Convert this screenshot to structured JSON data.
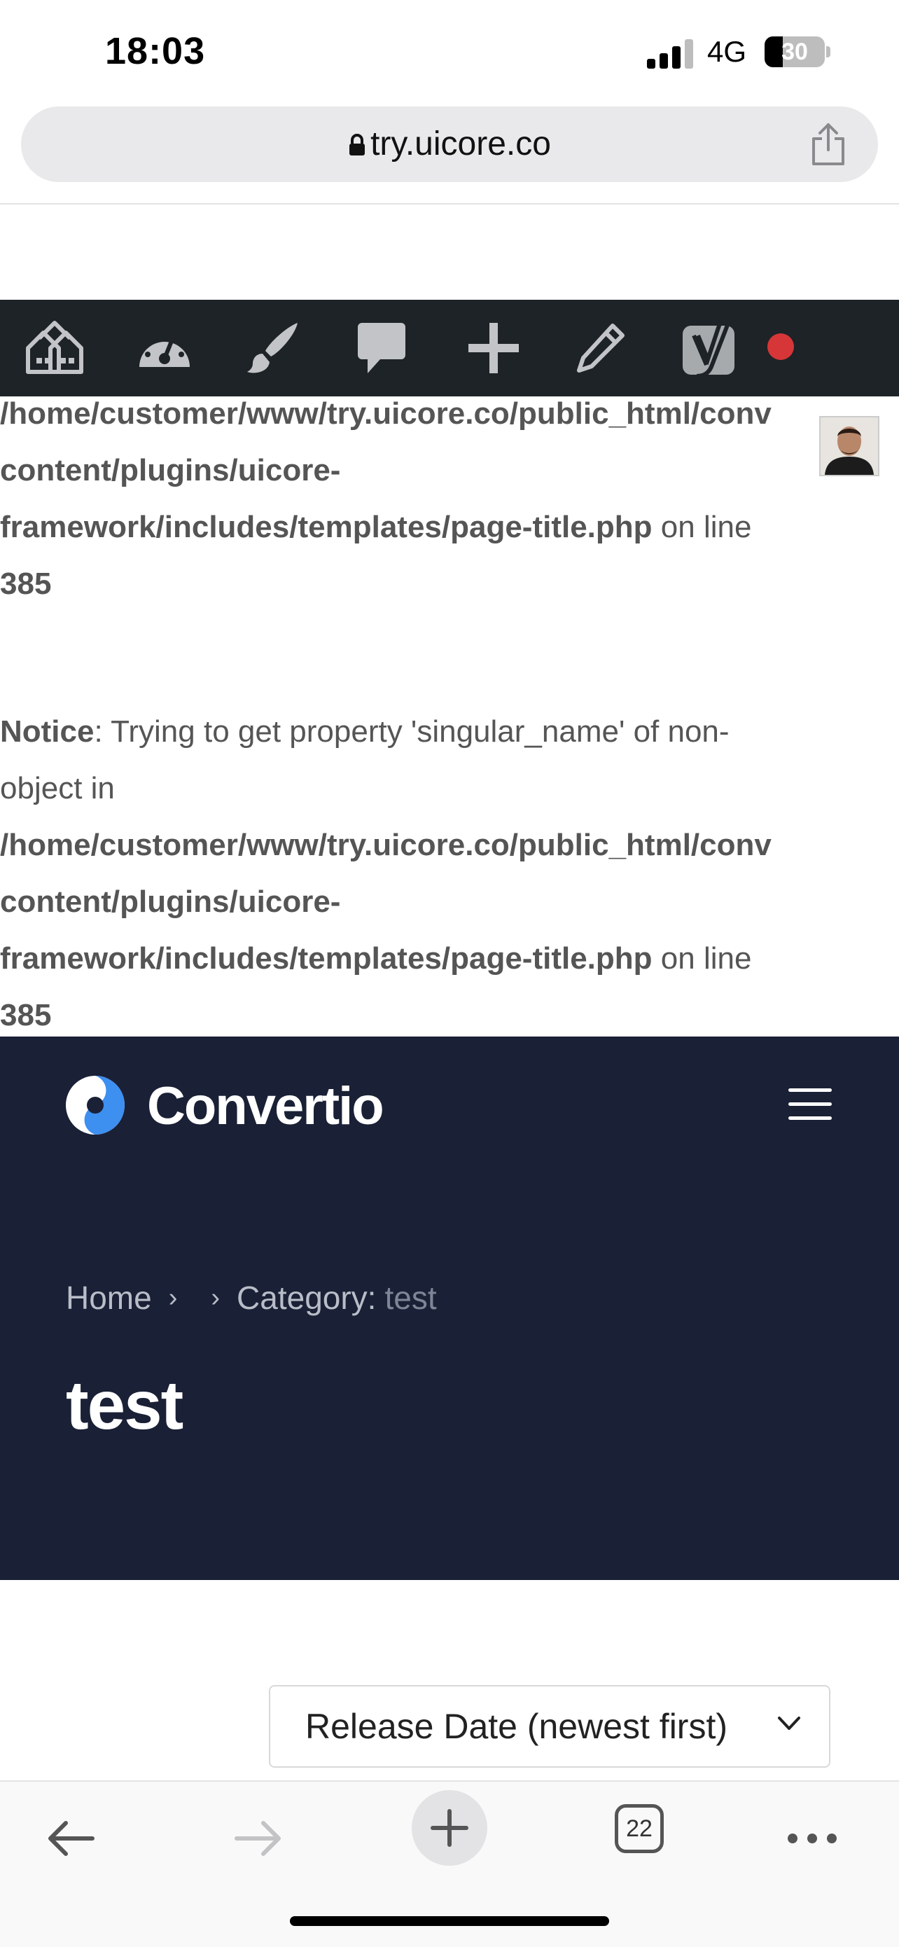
{
  "status_bar": {
    "time": "18:03",
    "network": "4G",
    "battery": "30"
  },
  "browser": {
    "url": "try.uicore.co"
  },
  "admin_bar": {
    "icons": [
      "multisite-icon",
      "dashboard-icon",
      "customize-icon",
      "comments-icon",
      "new-content-icon",
      "edit-icon",
      "yoast-icon",
      "record-icon"
    ]
  },
  "notices": {
    "first": {
      "path_line1": "/home/customer/www/try.uicore.co/public_html/",
      "path_cut": "conv",
      "path_line2": "content/plugins/uicore-",
      "path_line3": "framework/includes/templates/page-title.php",
      "on_line": "on line",
      "line_number": "385"
    },
    "second": {
      "label": "Notice",
      "message_line1": ": Trying to get property 'singular_name' of non-",
      "message_line2": "object in",
      "path_line1": "/home/customer/www/try.uicore.co/public_html/conv",
      "path_line2": "content/plugins/uicore-",
      "path_line3": "framework/includes/templates/page-title.php",
      "on_line": "on line",
      "line_number": "385"
    }
  },
  "site": {
    "logo_text": "Convertio",
    "breadcrumb": {
      "home": "Home",
      "sep1": "›",
      "sep2": "›",
      "category_label": "Category:",
      "category_value": "test"
    },
    "page_title": "test"
  },
  "sort": {
    "label": "Release Date (newest first)"
  },
  "toolbar": {
    "tabs_count": "22"
  },
  "colors": {
    "admin_bar": "#1d2327",
    "header_bg": "#1a2035",
    "accent": "#3d8ff0",
    "record": "#d63638"
  }
}
